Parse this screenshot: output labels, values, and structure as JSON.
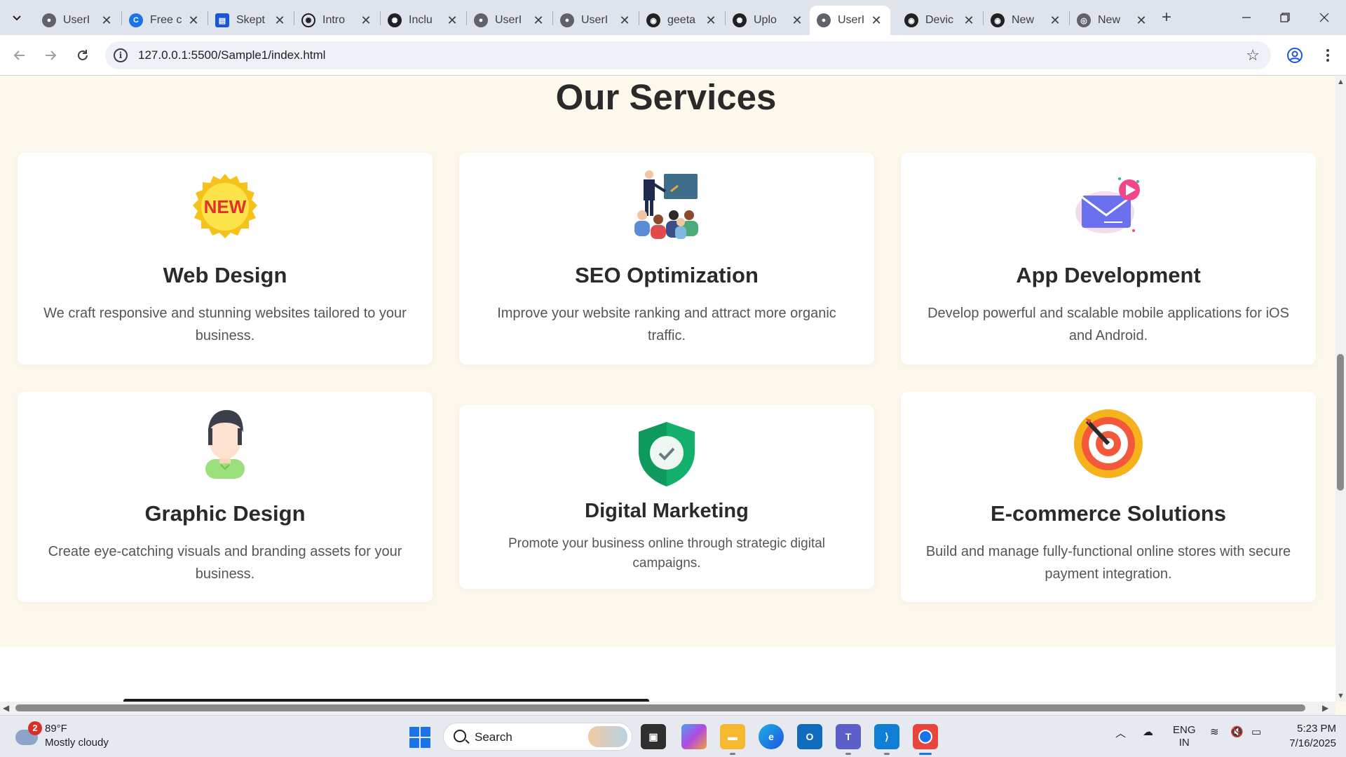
{
  "browser": {
    "tabs": [
      {
        "title": "UserI",
        "favicon": "globe-icon"
      },
      {
        "title": "Free c",
        "favicon": "copilot-icon"
      },
      {
        "title": "Skept",
        "favicon": "doc-icon"
      },
      {
        "title": "Intro",
        "favicon": "openai-icon"
      },
      {
        "title": "Inclu",
        "favicon": "openai-icon"
      },
      {
        "title": "UserI",
        "favicon": "globe-icon"
      },
      {
        "title": "UserI",
        "favicon": "globe-icon"
      },
      {
        "title": "geeta",
        "favicon": "github-icon"
      },
      {
        "title": "Uplo",
        "favicon": "openai-icon"
      },
      {
        "title": "UserI",
        "favicon": "globe-icon",
        "active": true
      },
      {
        "title": "Devic",
        "favicon": "github-icon"
      },
      {
        "title": "New",
        "favicon": "github-icon"
      },
      {
        "title": "New",
        "favicon": "chrome-icon"
      }
    ],
    "url": "127.0.0.1:5500/Sample1/index.html"
  },
  "page": {
    "heading": "Our Services",
    "services": [
      {
        "title": "Web Design",
        "description": "We craft responsive and stunning websites tailored to your business.",
        "icon": "new-badge-icon",
        "badge_text": "NEW"
      },
      {
        "title": "SEO Optimization",
        "description": "Improve your website ranking and attract more organic traffic.",
        "icon": "presentation-icon"
      },
      {
        "title": "App Development",
        "description": "Develop powerful and scalable mobile applications for iOS and Android.",
        "icon": "mail-play-icon"
      },
      {
        "title": "Graphic Design",
        "description": "Create eye-catching visuals and branding assets for your business.",
        "icon": "person-avatar-icon"
      },
      {
        "title": "Digital Marketing",
        "description": "Promote your business online through strategic digital campaigns.",
        "icon": "shield-check-icon"
      },
      {
        "title": "E-commerce Solutions",
        "description": "Build and manage fully-functional online stores with secure payment integration.",
        "icon": "target-icon"
      }
    ]
  },
  "taskbar": {
    "weather": {
      "badge": "2",
      "temp": "89°F",
      "condition": "Mostly cloudy"
    },
    "search_label": "Search",
    "language": {
      "line1": "ENG",
      "line2": "IN"
    },
    "time": "5:23 PM",
    "date": "7/16/2025"
  },
  "colors": {
    "page_bg": "#fdf8ec",
    "card_bg": "#ffffff",
    "heading": "#2a2a2a",
    "body_text": "#555555"
  }
}
